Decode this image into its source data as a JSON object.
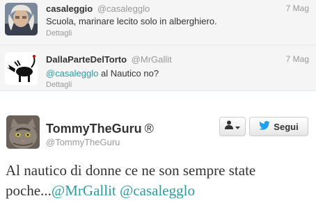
{
  "replies": [
    {
      "name": "casaleggio",
      "handle": "@casalegglo",
      "date": "7 Mag",
      "text": "Scuola, marinare lecito solo in alberghiero.",
      "details": "Dettagli"
    },
    {
      "name": "DallaParteDelTorto",
      "handle": "@MrGallit",
      "date": "7 Mag",
      "mention": "@casalegglo",
      "text_after": " al Nautico no?",
      "details": "Dettagli"
    }
  ],
  "main": {
    "name": "TommyTheGuru",
    "registered": "®",
    "handle": "@TommyTheGuru",
    "follow_label": "Segui",
    "text_part1": "Al nautico di donne ce ne son sempre state poche...",
    "mention1": "@MrGallit",
    "mention2": "@casalegglo"
  },
  "colors": {
    "mention": "#2a9c9f",
    "twitter_bird": "#1da1f2"
  },
  "icons": {
    "user_menu": "person-dropdown-icon",
    "follow": "twitter-bird-icon"
  }
}
